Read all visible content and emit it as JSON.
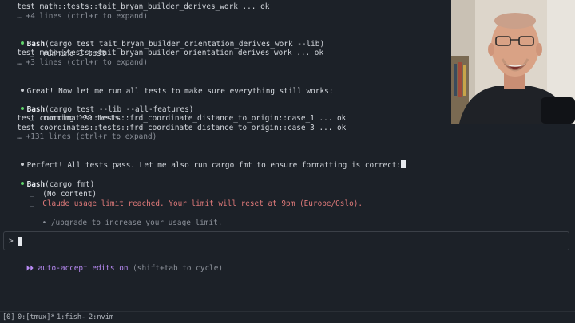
{
  "terminal": {
    "lines": {
      "l1": "  test math::tests::tait_bryan_builder_derives_work ... ok",
      "l2": "  … +4 lines (ctrl+r to expand)",
      "b1_tool": "Bash",
      "b1_args": "(cargo test tait_bryan_builder_orientation_derives_work --lib)",
      "b1_o1": "running 1 test",
      "b1_o2": "  test math::tests::tait_bryan_builder_orientation_derives_work ... ok",
      "b1_o3": "  … +3 lines (ctrl+r to expand)",
      "msg1": "Great! Now let me run all tests to make sure everything still works:",
      "b2_tool": "Bash",
      "b2_args": "(cargo test --lib --all-features)",
      "b2_o1": "running 129 tests",
      "b2_o2": "  test coordinates::tests::frd_coordinate_distance_to_origin::case_1 ... ok",
      "b2_o3": "  test coordinates::tests::frd_coordinate_distance_to_origin::case_3 ... ok",
      "b2_o4": "  … +131 lines (ctrl+r to expand)",
      "msg2": "Perfect! All tests pass. Let me also run cargo fmt to ensure formatting is correct:",
      "b3_tool": "Bash",
      "b3_args": "(cargo fmt)",
      "b3_o1": "(No content)",
      "b3_o2": "Claude usage limit reached. Your limit will reset at 9pm (Europe/Oslo).",
      "upgrade": "/upgrade to increase your usage limit."
    },
    "elbow": "⎿",
    "bullet": "•"
  },
  "input": {
    "prompt": ">"
  },
  "mode": {
    "arrows": "⏵⏵",
    "text": "auto-accept edits on",
    "hint": " (shift+tab to cycle)"
  },
  "statusbar": {
    "session": "[0]",
    "win0": "0:[tmux]*",
    "win1": "1:fish-",
    "win2": "2:nvim"
  },
  "colors": {
    "background": "#1c2128",
    "error": "#e07a7a",
    "success_dot": "#5fd36a",
    "mode_accent": "#b98bf5"
  },
  "icons": [
    "green-status-dot-icon",
    "white-bullet-dot-icon",
    "elbow-connector-icon",
    "mode-arrows-icon",
    "cursor-icon"
  ]
}
